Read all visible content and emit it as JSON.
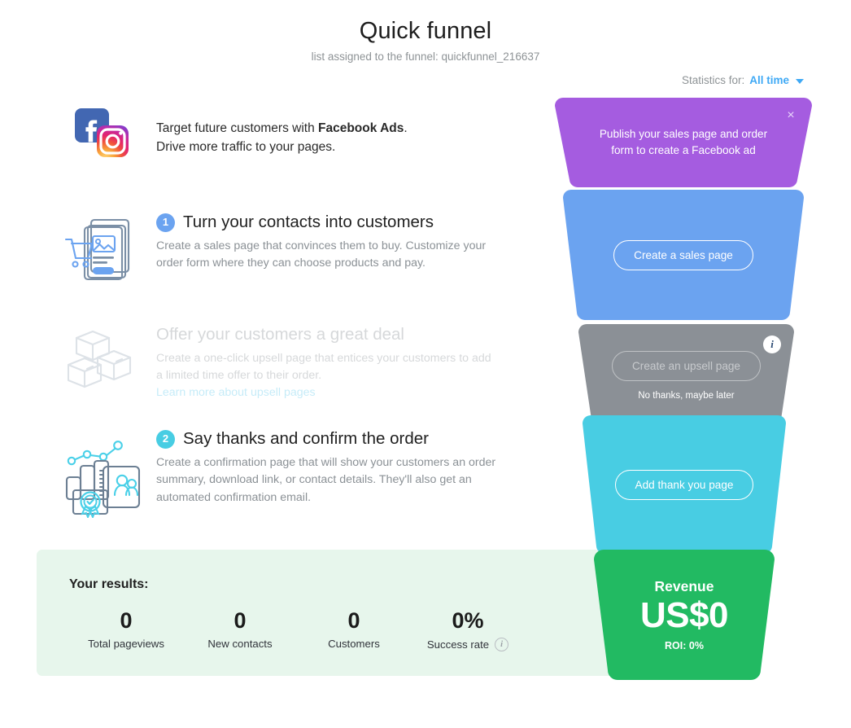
{
  "header": {
    "title": "Quick funnel",
    "subtitle": "list assigned to the funnel: quickfunnel_216637",
    "stats_label": "Statistics for:",
    "stats_value": "All time"
  },
  "facebook_promo": {
    "text_prefix": "Target future customers with ",
    "text_bold": "Facebook Ads",
    "text_suffix": ".",
    "line2": "Drive more traffic to your pages."
  },
  "steps": [
    {
      "number": "1",
      "title": "Turn your contacts into customers",
      "body": "Create a sales page that convinces them to buy. Customize your order form where they can choose products and pay."
    },
    {
      "number": "",
      "title": "Offer your customers a great deal",
      "body": "Create a one-click upsell page that entices your customers to add a limited time offer to their order.",
      "link": "Learn more about upsell pages"
    },
    {
      "number": "2",
      "title": "Say thanks and confirm the order",
      "body": "Create a confirmation page that will show your customers an order summary, download link, or contact details. They'll also get an automated confirmation email."
    }
  ],
  "results": {
    "title": "Your results:",
    "items": [
      {
        "value": "0",
        "label": "Total pageviews"
      },
      {
        "value": "0",
        "label": "New contacts"
      },
      {
        "value": "0",
        "label": "Customers"
      },
      {
        "value": "0%",
        "label": "Success rate",
        "info": "i"
      }
    ]
  },
  "funnel": {
    "promo": {
      "text": "Publish your sales page and order form to create a Facebook ad",
      "close": "×",
      "color": "#a55ce0"
    },
    "sales": {
      "button": "Create a sales page",
      "color": "#6ba3f0"
    },
    "upsell": {
      "button": "Create an upsell page",
      "secondary": "No thanks, maybe later",
      "info": "i",
      "color": "#8b9096"
    },
    "thankyou": {
      "button": "Add thank you page",
      "color": "#48cde3"
    },
    "revenue": {
      "label": "Revenue",
      "value": "US$0",
      "roi": "ROI: 0%",
      "color": "#22ba62"
    }
  }
}
